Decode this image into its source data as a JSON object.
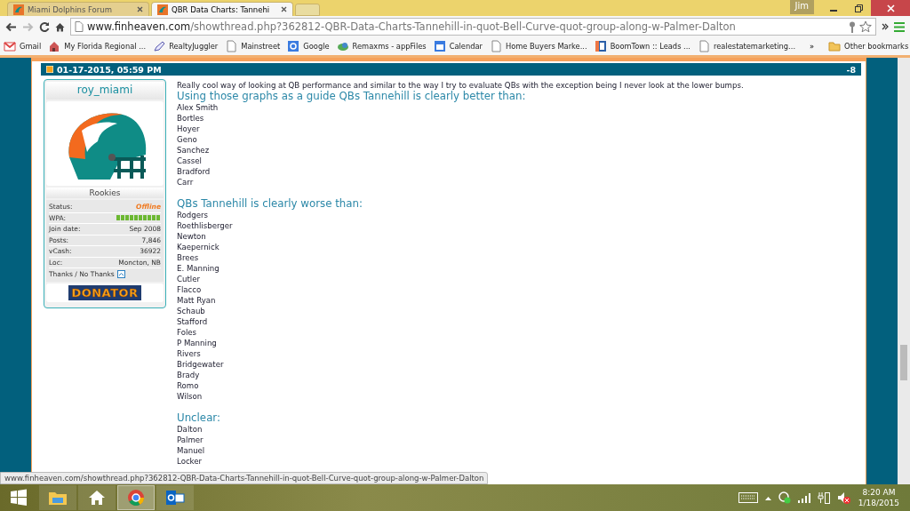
{
  "browser": {
    "tabs": [
      {
        "title": "Miami Dolphins Forum",
        "selected": false
      },
      {
        "title": "QBR Data Charts: Tannehi",
        "selected": true
      }
    ],
    "user": "Jim",
    "address": {
      "domain": "www.finheaven.com",
      "path": "/showthread.php?362812-QBR-Data-Charts-Tannehill-in-quot-Bell-Curve-quot-group-along-w-Palmer-Dalton"
    },
    "bookmarks": [
      {
        "label": "Gmail",
        "kind": "gmail"
      },
      {
        "label": "My Florida Regional ...",
        "kind": "house"
      },
      {
        "label": "RealtyJuggler",
        "kind": "pen"
      },
      {
        "label": "Mainstreet",
        "kind": "page"
      },
      {
        "label": "Google",
        "kind": "google"
      },
      {
        "label": "Remaxms - appFiles",
        "kind": "cloud"
      },
      {
        "label": "Calendar",
        "kind": "calendar"
      },
      {
        "label": "Home Buyers Marke...",
        "kind": "page"
      },
      {
        "label": "BoomTown :: Leads ...",
        "kind": "boomtown"
      },
      {
        "label": "realestatemarketing...",
        "kind": "page"
      }
    ],
    "overflow": "»",
    "other_bookmarks": "Other bookmarks"
  },
  "post": {
    "date": "01-17-2015, 05:59 PM",
    "number": "-8",
    "author": {
      "name": "roy_miami",
      "rank": "Rookies",
      "fields": [
        {
          "label": "Status:",
          "value": "Offline",
          "kind": "status"
        },
        {
          "label": "WPA:",
          "level": 1,
          "kind": "meter"
        },
        {
          "label": "Join date:",
          "value": "Sep 2008",
          "kind": "text"
        },
        {
          "label": "Posts:",
          "value": "7,846",
          "kind": "text"
        },
        {
          "label": "vCash:",
          "value": "36922",
          "kind": "text"
        },
        {
          "label": "Loc:",
          "value": "Moncton, NB",
          "kind": "text"
        }
      ],
      "thanks": "Thanks / No Thanks",
      "badge": "DONATOR"
    },
    "body": [
      {
        "kind": "line",
        "text": "Really cool way of looking at QB performance and similar to the way I try to evaluate QBs with the exception being I never look at the lower bumps."
      },
      {
        "kind": "heading",
        "text": "Using those graphs as a guide QBs Tannehill is clearly better than:"
      },
      {
        "kind": "list",
        "items": [
          "Alex Smith",
          "Bortles",
          "Hoyer",
          "Geno",
          "Sanchez",
          "Cassel",
          "Bradford",
          "Carr"
        ]
      },
      {
        "kind": "heading",
        "text": "QBs Tannehill is clearly worse than:"
      },
      {
        "kind": "list",
        "items": [
          "Rodgers",
          "Roethlisberger",
          "Newton",
          "Kaepernick",
          "Brees",
          "E. Manning",
          "Cutler",
          "Flacco",
          "Matt Ryan",
          "Schaub",
          "Stafford",
          "Foles",
          "P Manning",
          "Rivers",
          "Bridgewater",
          "Brady",
          "Romo",
          "Wilson"
        ]
      },
      {
        "kind": "heading",
        "text": "Unclear:"
      },
      {
        "kind": "list",
        "items": [
          "Dalton",
          "Palmer",
          "Manuel",
          "Locker"
        ]
      }
    ]
  },
  "status_url": "www.finheaven.com/showthread.php?362812-QBR-Data-Charts-Tannehill-in-quot-Bell-Curve-quot-group-along-w-Palmer-Dalton",
  "taskbar": {
    "apps": [
      {
        "kind": "files",
        "selected": false
      },
      {
        "kind": "home",
        "selected": false
      },
      {
        "kind": "chrome",
        "selected": true
      },
      {
        "kind": "outlook",
        "selected": false
      }
    ],
    "time": "8:20 AM",
    "date": "1/18/2015"
  }
}
